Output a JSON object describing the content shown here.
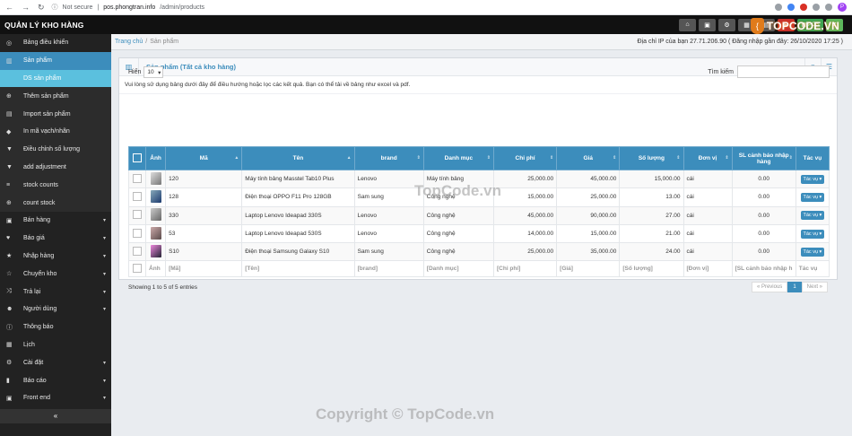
{
  "browser": {
    "security": "Not secure",
    "url_host": "pos.phongtran.info",
    "url_path": "/admin/products",
    "profile": "P"
  },
  "app": {
    "brand": "QUẢN LÝ KHO HÀNG",
    "pos_label": "POS",
    "logo_text": "TOPCODE.VN"
  },
  "sidebar": {
    "items": [
      {
        "label": "Bảng điều khiển",
        "icon": "dashboard-icon"
      },
      {
        "label": "Sản phẩm",
        "icon": "barcode-icon"
      },
      {
        "label": "DS sản phẩm",
        "icon": ""
      },
      {
        "label": "Thêm sản phẩm",
        "icon": "plus-circle-icon"
      },
      {
        "label": "Import sản phẩm",
        "icon": "file-icon"
      },
      {
        "label": "In mã vạch/nhãn",
        "icon": "tag-icon"
      },
      {
        "label": "Điều chỉnh số lượng",
        "icon": "filter-icon"
      },
      {
        "label": "add adjustment",
        "icon": "filter-icon"
      },
      {
        "label": "stock counts",
        "icon": "list-icon"
      },
      {
        "label": "count stock",
        "icon": "plus-circle-icon"
      },
      {
        "label": "Bán hàng",
        "icon": "cart-icon"
      },
      {
        "label": "Báo giá",
        "icon": "heart-icon"
      },
      {
        "label": "Nhập hàng",
        "icon": "star-icon"
      },
      {
        "label": "Chuyển kho",
        "icon": "star-outline-icon"
      },
      {
        "label": "Trả lại",
        "icon": "random-icon"
      },
      {
        "label": "Người dùng",
        "icon": "users-icon"
      },
      {
        "label": "Thông báo",
        "icon": "info-icon"
      },
      {
        "label": "Lịch",
        "icon": "calendar-icon"
      },
      {
        "label": "Cài đặt",
        "icon": "cog-icon"
      },
      {
        "label": "Báo cáo",
        "icon": "chart-icon"
      },
      {
        "label": "Front end",
        "icon": "cart-icon"
      }
    ],
    "collapse": "«"
  },
  "breadcrumb": {
    "home": "Trang chủ",
    "sep": "/",
    "current": "Sản phẩm",
    "ip_info": "Địa chỉ IP của bạn 27.71.206.90 ( Đăng nhập gần đây: 26/10/2020 17:25 )"
  },
  "panel": {
    "title": "Sản phẩm (Tất cả kho hàng)",
    "intro": "Vui lòng sử dụng bảng dưới đây để điều hướng hoặc lọc các kết quả. Bạn có thể tải về bảng như excel và pdf."
  },
  "table_controls": {
    "show_label": "Hiển",
    "page_size": "10",
    "search_label": "Tìm kiếm"
  },
  "table": {
    "headers": [
      "Ảnh",
      "Mã",
      "Tên",
      "brand",
      "Danh mục",
      "Chi phí",
      "Giá",
      "Số lượng",
      "Đơn vị",
      "SL cảnh báo nhập hàng",
      "Tác vụ"
    ],
    "rows": [
      {
        "code": "120",
        "name": "Máy tính bảng Masstel Tab10 Plus",
        "brand": "Lenovo",
        "category": "Máy tính bảng",
        "cost": "25,000.00",
        "price": "45,000.00",
        "qty": "15,000.00",
        "unit": "cái",
        "alert": "0.00"
      },
      {
        "code": "128",
        "name": "Điện thoại OPPO F11 Pro 128GB",
        "brand": "Sam sung",
        "category": "Công nghệ",
        "cost": "15,000.00",
        "price": "25,000.00",
        "qty": "13.00",
        "unit": "cái",
        "alert": "0.00"
      },
      {
        "code": "330",
        "name": "Laptop Lenovo Ideapad 330S",
        "brand": "Lenovo",
        "category": "Công nghệ",
        "cost": "45,000.00",
        "price": "90,000.00",
        "qty": "27.00",
        "unit": "cái",
        "alert": "0.00"
      },
      {
        "code": "53",
        "name": "Laptop Lenovo Ideapad 530S",
        "brand": "Lenovo",
        "category": "Công nghệ",
        "cost": "14,000.00",
        "price": "15,000.00",
        "qty": "21.00",
        "unit": "cái",
        "alert": "0.00"
      },
      {
        "code": "S10",
        "name": "Điện thoại Samsung Galaxy S10",
        "brand": "Sam sung",
        "category": "Công nghệ",
        "cost": "25,000.00",
        "price": "35,000.00",
        "qty": "24.00",
        "unit": "cái",
        "alert": "0.00"
      }
    ],
    "action_label": "Tác vụ ▾",
    "footer": [
      "Ảnh",
      "[Mã]",
      "[Tên]",
      "[brand]",
      "[Danh mục]",
      "[Chi phí]",
      "[Giá]",
      "[Số lượng]",
      "[Đơn vị]",
      "[SL cảnh báo nhập h",
      "Tác vụ"
    ]
  },
  "pagination": {
    "info": "Showing 1 to 5 of 5 entries",
    "prev": "« Previous",
    "page": "1",
    "next": "Next »"
  },
  "watermarks": {
    "center": "TopCode.vn",
    "bottom": "Copyright © TopCode.vn"
  }
}
